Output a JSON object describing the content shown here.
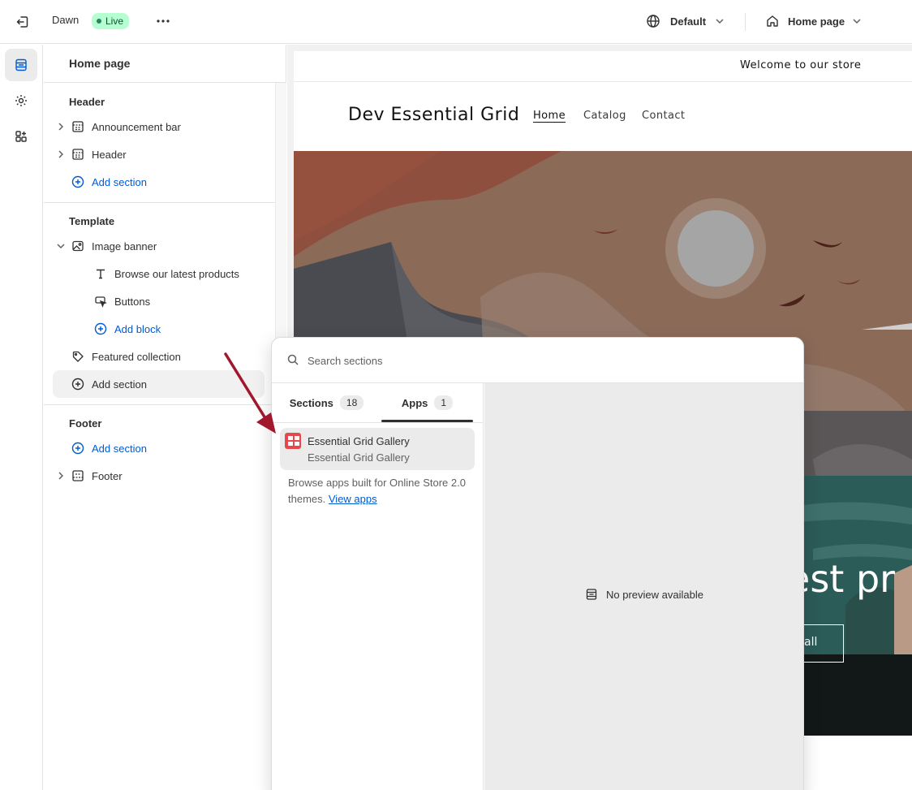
{
  "topbar": {
    "theme_name": "Dawn",
    "status_badge": "Live",
    "locale_label": "Default",
    "page_label": "Home page"
  },
  "rail": {
    "items": [
      "sections-icon",
      "settings-icon",
      "apps-icon"
    ]
  },
  "sidebar": {
    "title": "Home page",
    "header_group": {
      "label": "Header",
      "items": [
        "Announcement bar",
        "Header"
      ],
      "add_label": "Add section"
    },
    "template_group": {
      "label": "Template",
      "image_banner": "Image banner",
      "blocks": [
        "Browse our latest products",
        "Buttons"
      ],
      "add_block": "Add block",
      "featured": "Featured collection",
      "add_label": "Add section"
    },
    "footer_group": {
      "label": "Footer",
      "add_label": "Add section",
      "items": [
        "Footer"
      ]
    }
  },
  "preview": {
    "announcement": "Welcome to our store",
    "brand": "Dev Essential Grid",
    "nav": [
      "Home",
      "Catalog",
      "Contact"
    ],
    "banner_heading_fragment": "test pr",
    "banner_button_fragment": "all"
  },
  "popover": {
    "search_placeholder": "Search sections",
    "tabs": [
      {
        "label": "Sections",
        "count": "18"
      },
      {
        "label": "Apps",
        "count": "1"
      }
    ],
    "app": {
      "name": "Essential Grid Gallery",
      "subtitle": "Essential Grid Gallery"
    },
    "browse_text": "Browse apps built for Online Store 2.0 themes.",
    "browse_link": "View apps",
    "no_preview": "No preview available"
  },
  "colors": {
    "accent_blue": "#005bd3",
    "live_badge_bg": "#b4fed2",
    "app_logo": "#e5484d",
    "annotation_arrow": "#a1172b"
  }
}
